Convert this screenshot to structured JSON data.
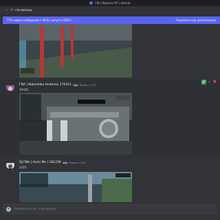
{
  "window": {
    "title": "FIB | Majestic RP | Atlanta"
  },
  "channel": {
    "name": "гос-волны"
  },
  "banner": {
    "left": "775 новых сообщений с 09:52 августа 2025 г.",
    "right": "Пометить как прочитанное"
  },
  "messages": [
    {
      "author": "FNA | Kokushibo Andoniio 170311",
      "tag": "FNA",
      "time": "Вчера, в 4:25",
      "text": "10:05"
    },
    {
      "author": "DJ.FNA | Archi Mo | 181236",
      "tag": "FNA",
      "time": "Вчера, в 4:31",
      "text": "1/10"
    }
  ],
  "composer": {
    "placeholder": "Написать в # · гос-волны"
  },
  "colors": {
    "accent": "#5865f2",
    "background": "#313338",
    "titlebar": "#1e1f22"
  }
}
